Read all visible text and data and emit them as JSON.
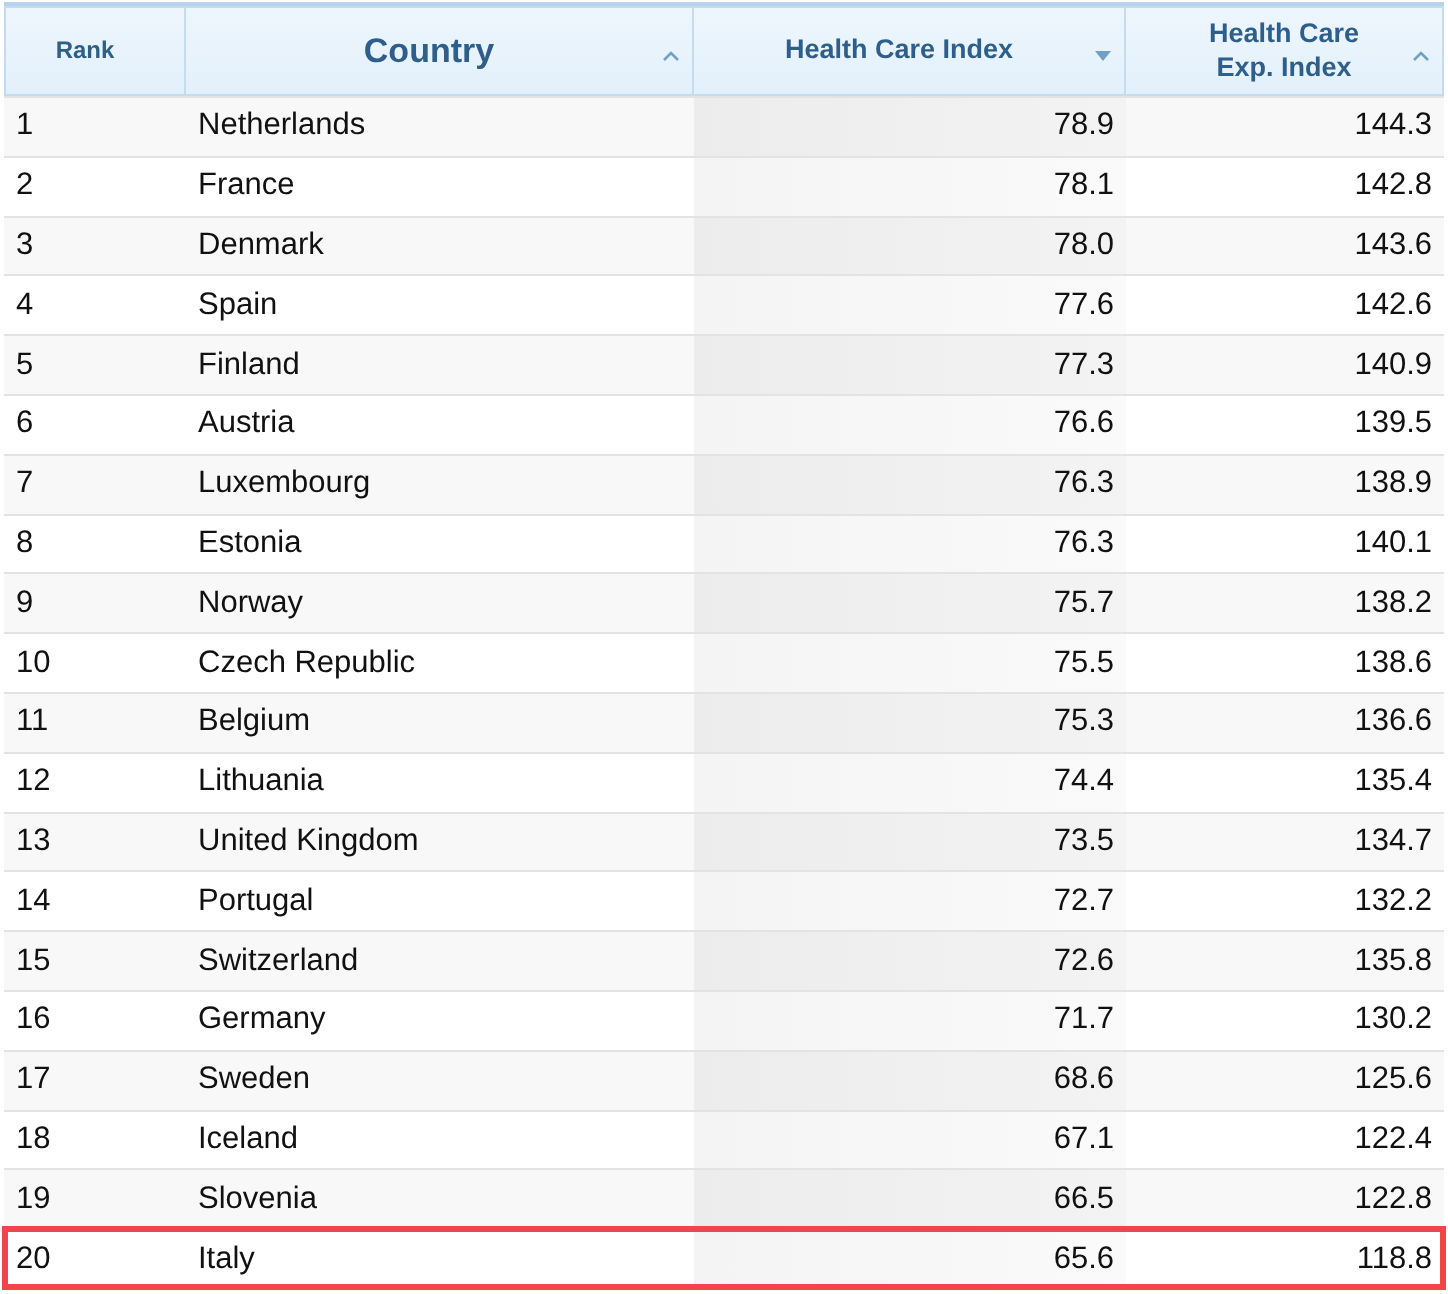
{
  "table": {
    "columns": [
      {
        "label": "Rank",
        "sortable": false,
        "selected": false
      },
      {
        "label": "Country",
        "sortable": true,
        "selected": false
      },
      {
        "label": "Health Care Index",
        "sortable": true,
        "selected": true
      },
      {
        "label": "Health Care Exp. Index",
        "sortable": true,
        "selected": false
      }
    ],
    "rows": [
      {
        "cells": [
          "1",
          "Netherlands",
          "78.9",
          "144.3"
        ],
        "highlighted": false
      },
      {
        "cells": [
          "2",
          "France",
          "78.1",
          "142.8"
        ],
        "highlighted": false
      },
      {
        "cells": [
          "3",
          "Denmark",
          "78.0",
          "143.6"
        ],
        "highlighted": false
      },
      {
        "cells": [
          "4",
          "Spain",
          "77.6",
          "142.6"
        ],
        "highlighted": false
      },
      {
        "cells": [
          "5",
          "Finland",
          "77.3",
          "140.9"
        ],
        "highlighted": false
      },
      {
        "cells": [
          "6",
          "Austria",
          "76.6",
          "139.5"
        ],
        "highlighted": false
      },
      {
        "cells": [
          "7",
          "Luxembourg",
          "76.3",
          "138.9"
        ],
        "highlighted": false
      },
      {
        "cells": [
          "8",
          "Estonia",
          "76.3",
          "140.1"
        ],
        "highlighted": false
      },
      {
        "cells": [
          "9",
          "Norway",
          "75.7",
          "138.2"
        ],
        "highlighted": false
      },
      {
        "cells": [
          "10",
          "Czech Republic",
          "75.5",
          "138.6"
        ],
        "highlighted": false
      },
      {
        "cells": [
          "11",
          "Belgium",
          "75.3",
          "136.6"
        ],
        "highlighted": false
      },
      {
        "cells": [
          "12",
          "Lithuania",
          "74.4",
          "135.4"
        ],
        "highlighted": false
      },
      {
        "cells": [
          "13",
          "United Kingdom",
          "73.5",
          "134.7"
        ],
        "highlighted": false
      },
      {
        "cells": [
          "14",
          "Portugal",
          "72.7",
          "132.2"
        ],
        "highlighted": false
      },
      {
        "cells": [
          "15",
          "Switzerland",
          "72.6",
          "135.8"
        ],
        "highlighted": false
      },
      {
        "cells": [
          "16",
          "Germany",
          "71.7",
          "130.2"
        ],
        "highlighted": false
      },
      {
        "cells": [
          "17",
          "Sweden",
          "68.6",
          "125.6"
        ],
        "highlighted": false
      },
      {
        "cells": [
          "18",
          "Iceland",
          "67.1",
          "122.4"
        ],
        "highlighted": false
      },
      {
        "cells": [
          "19",
          "Slovenia",
          "66.5",
          "122.8"
        ],
        "highlighted": false
      },
      {
        "cells": [
          "20",
          "Italy",
          "65.6",
          "118.8"
        ],
        "highlighted": true
      }
    ]
  }
}
